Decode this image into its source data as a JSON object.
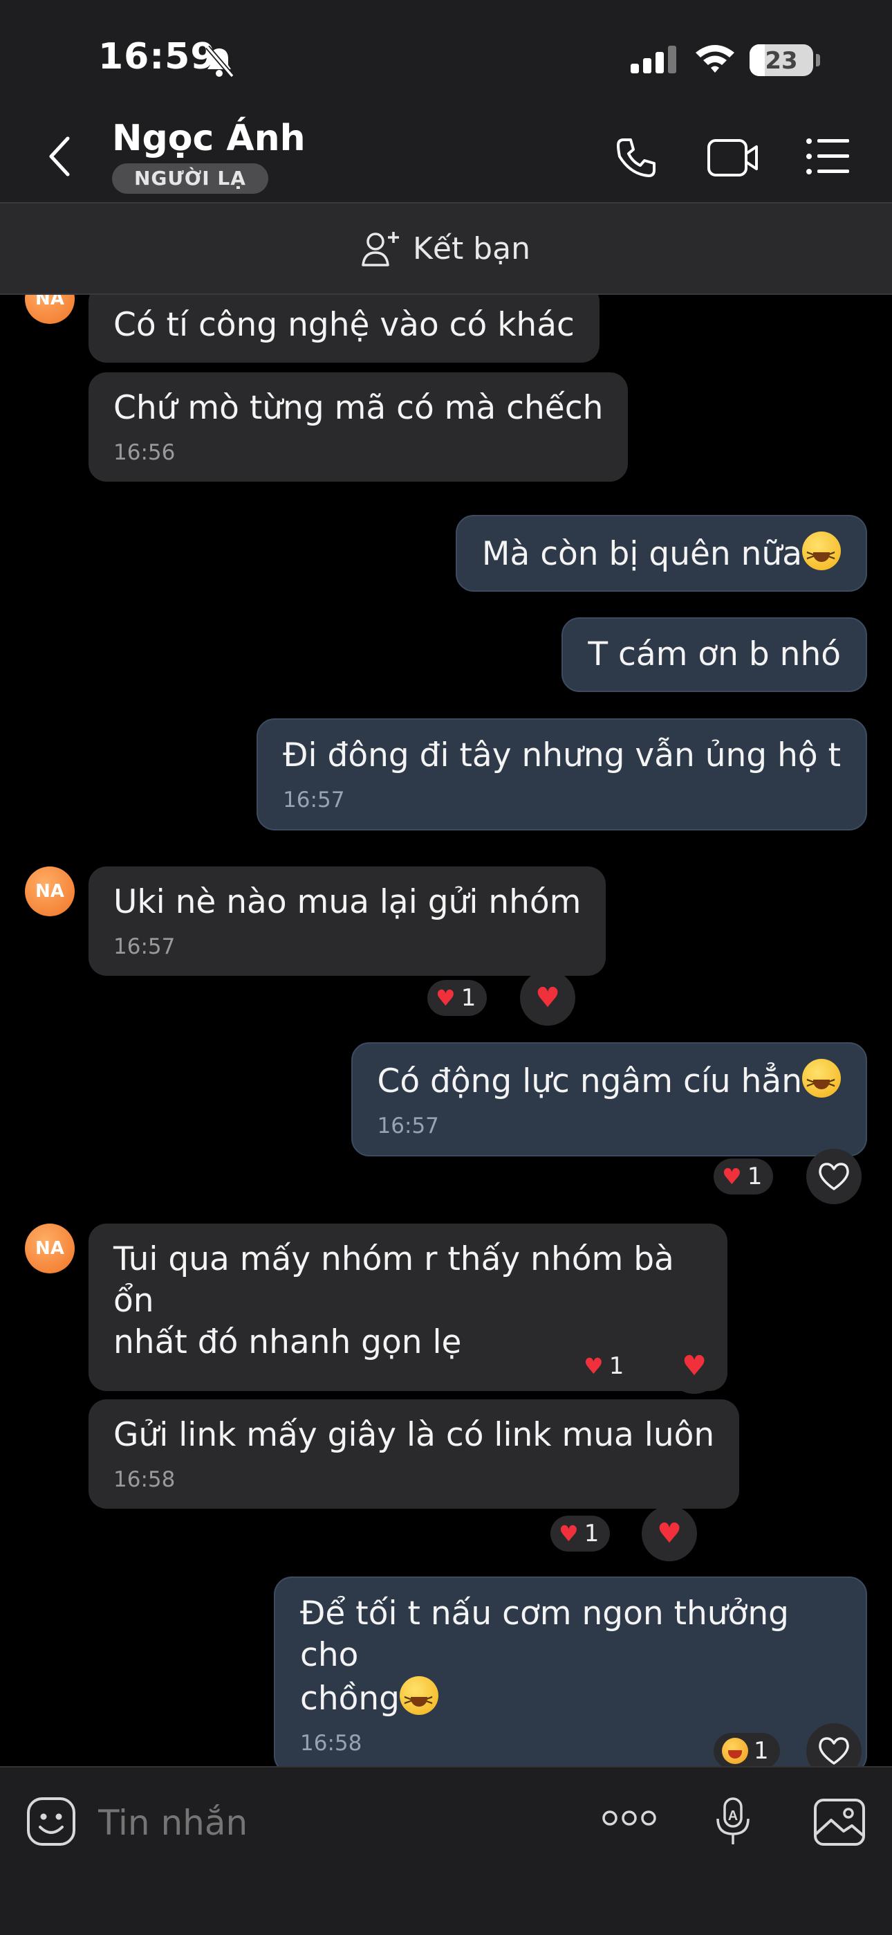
{
  "status": {
    "time": "16:59",
    "battery": "23"
  },
  "header": {
    "name": "Ngọc Ánh",
    "badge": "NGƯỜI LẠ"
  },
  "friend_bar": {
    "label": "Kết bạn"
  },
  "avatar_initials": "NA",
  "messages": [
    {
      "text": "Có tí công nghệ vào có khác"
    },
    {
      "text": "Chứ mò từng mã có mà chếch",
      "time": "16:56"
    },
    {
      "text": "Mà còn bị quên nữa"
    },
    {
      "text": "T cám ơn b nhó"
    },
    {
      "text": "Đi đông đi tây nhưng vẫn ủng hộ t",
      "time": "16:57"
    },
    {
      "text": "Uki nè nào mua lại gửi nhóm",
      "time": "16:57",
      "reaction_count": "1"
    },
    {
      "text": "Có động lực ngâm cíu hẳn",
      "time": "16:57",
      "reaction_count": "1"
    },
    {
      "line1": "Tui qua mấy nhóm r thấy nhóm bà ổn",
      "line2": "nhất đó nhanh gọn lẹ",
      "reaction_count": "1"
    },
    {
      "text": "Gửi link mấy giây là có link mua luôn",
      "time": "16:58",
      "reaction_count": "1"
    },
    {
      "line1": "Để tối t nấu cơm ngon thưởng cho",
      "line2": "chồng",
      "time": "16:58",
      "reaction_count": "1"
    }
  ],
  "input": {
    "placeholder": "Tin nhắn"
  },
  "colors": {
    "heart": "#f0303a",
    "outgoing_bubble": "#2e3a4a",
    "incoming_bubble": "#2a2a2c"
  }
}
